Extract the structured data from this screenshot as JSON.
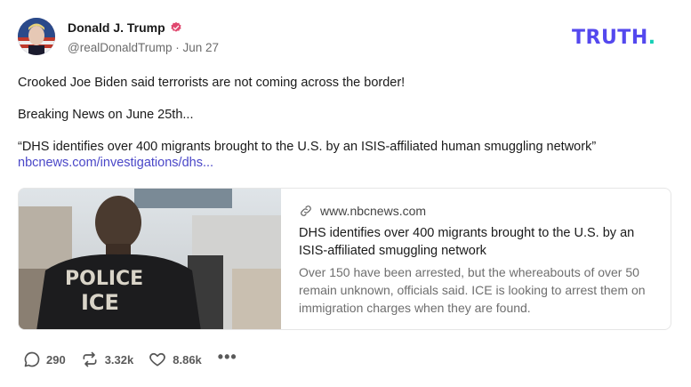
{
  "author": {
    "name": "Donald J. Trump",
    "handle": "@realDonaldTrump",
    "separator": "·",
    "date": "Jun 27",
    "verified_icon": "verified-badge-icon",
    "badge_color": "#e0486f"
  },
  "brand": {
    "logo_text": "TRUTH",
    "logo_dot": ".",
    "primary_color": "#5448ee",
    "dot_color": "#16d0b6"
  },
  "post": {
    "line1": "Crooked Joe Biden said terrorists are not coming across the border!",
    "line2": "Breaking News on June 25th...",
    "line3": "“DHS identifies over 400 migrants brought to the U.S. by an ISIS-affiliated human smuggling network”",
    "link": "nbcnews.com/investigations/dhs..."
  },
  "link_card": {
    "domain": "www.nbcnews.com",
    "link_icon": "link-icon",
    "title": "DHS identifies over 400 migrants brought to the U.S. by an ISIS-affiliated smuggling network",
    "description": "Over 150 have been arrested, but the whereabouts of over 50 remain unknown, officials said. ICE is looking to arrest them on immigration charges when they are found.",
    "image_text_line1": "POLICE",
    "image_text_line2": "ICE"
  },
  "actions": {
    "replies": "290",
    "retruths": "3.32k",
    "likes": "8.86k",
    "more": "•••"
  }
}
